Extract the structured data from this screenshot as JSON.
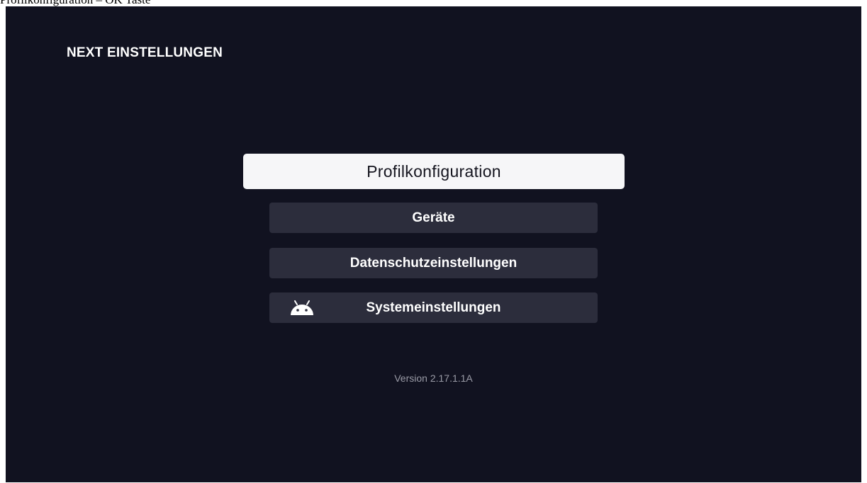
{
  "caption": "Profilkonfiguration – OK Taste",
  "header": {
    "title": "NEXT EINSTELLUNGEN"
  },
  "menu": {
    "items": [
      {
        "label": "Profilkonfiguration",
        "focused": true
      },
      {
        "label": "Geräte",
        "focused": false
      },
      {
        "label": "Datenschutzeinstellungen",
        "focused": false
      },
      {
        "label": "Systemeinstellungen",
        "focused": false,
        "icon": "android-icon"
      }
    ]
  },
  "footer": {
    "version": "Version 2.17.1.1A"
  },
  "colors": {
    "background": "#111220",
    "focused_button": "#f6f6f8",
    "button": "#2c2d3c",
    "text": "#ffffff",
    "version_text": "#9a9ba6"
  }
}
